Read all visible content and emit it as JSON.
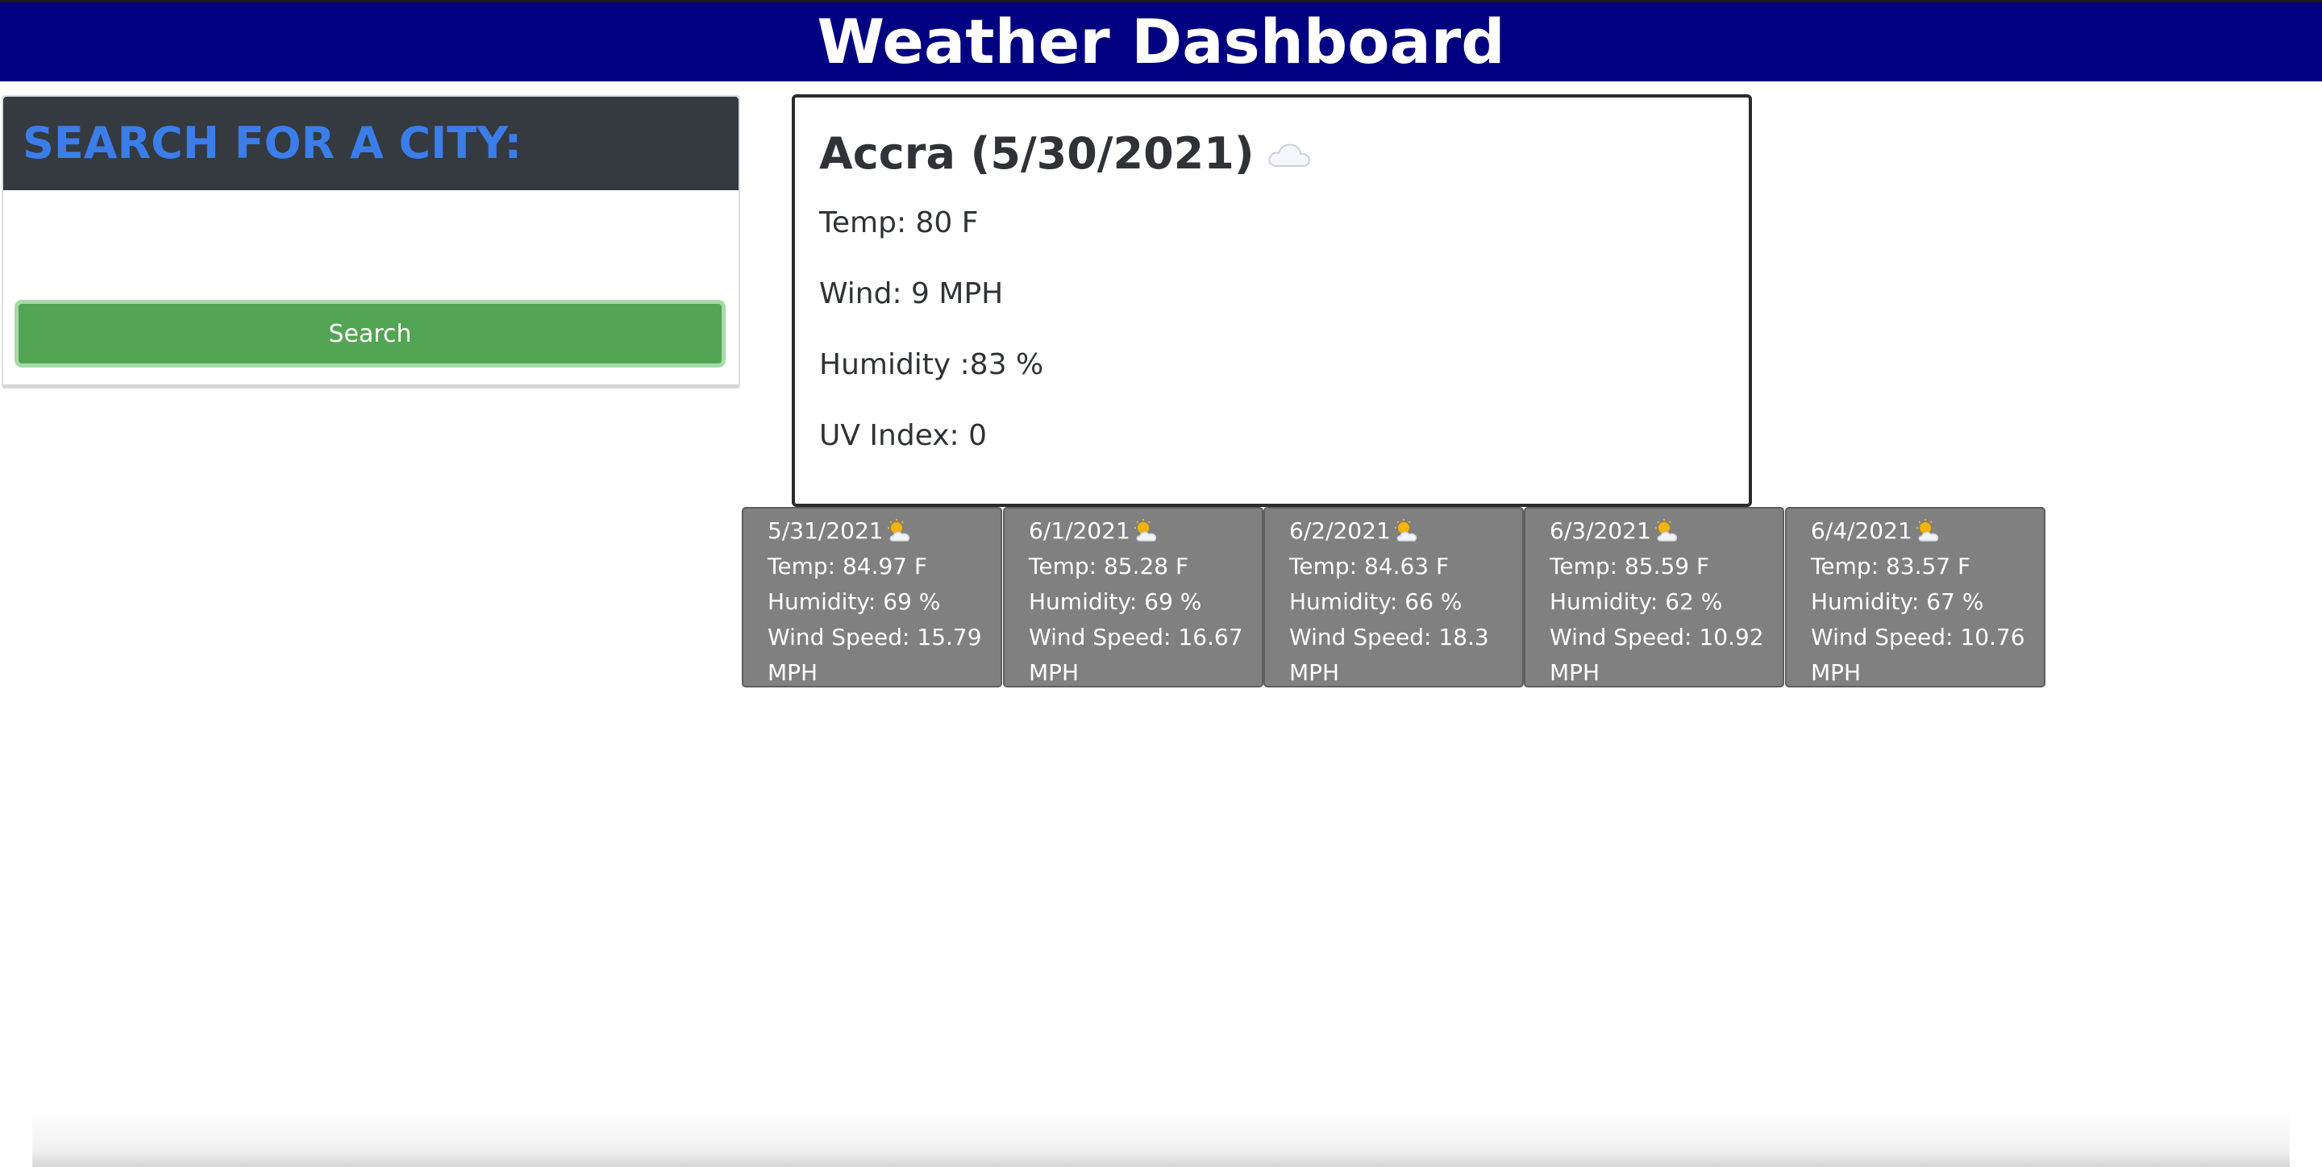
{
  "header": {
    "title": "Weather Dashboard"
  },
  "search": {
    "heading": "SEARCH FOR A CITY:",
    "input_value": "",
    "button_label": "Search"
  },
  "current": {
    "title": "Accra (5/30/2021)",
    "icon": "cloud-icon",
    "temp": "Temp: 80 F",
    "wind": "Wind: 9 MPH",
    "humidity": "Humidity :83 %",
    "uv": "UV Index: 0"
  },
  "forecast": [
    {
      "date": "5/31/2021",
      "icon": "sun-behind-cloud-icon",
      "temp": "Temp: 84.97 F",
      "humidity": "Humidity: 69 %",
      "wind": "Wind Speed: 15.79 MPH"
    },
    {
      "date": "6/1/2021",
      "icon": "sun-behind-cloud-icon",
      "temp": "Temp: 85.28 F",
      "humidity": "Humidity: 69 %",
      "wind": "Wind Speed: 16.67 MPH"
    },
    {
      "date": "6/2/2021",
      "icon": "sun-behind-cloud-icon",
      "temp": "Temp: 84.63 F",
      "humidity": "Humidity: 66 %",
      "wind": "Wind Speed: 18.3 MPH"
    },
    {
      "date": "6/3/2021",
      "icon": "sun-behind-cloud-icon",
      "temp": "Temp: 85.59 F",
      "humidity": "Humidity: 62 %",
      "wind": "Wind Speed: 10.92 MPH"
    },
    {
      "date": "6/4/2021",
      "icon": "sun-behind-cloud-icon",
      "temp": "Temp: 83.57 F",
      "humidity": "Humidity: 67 %",
      "wind": "Wind Speed: 10.76 MPH"
    }
  ],
  "colors": {
    "header_bg": "#000080",
    "search_heading": "#3b7de9",
    "search_head_bg": "#343a40",
    "search_button": "#52a552",
    "forecast_bg": "#808080"
  }
}
